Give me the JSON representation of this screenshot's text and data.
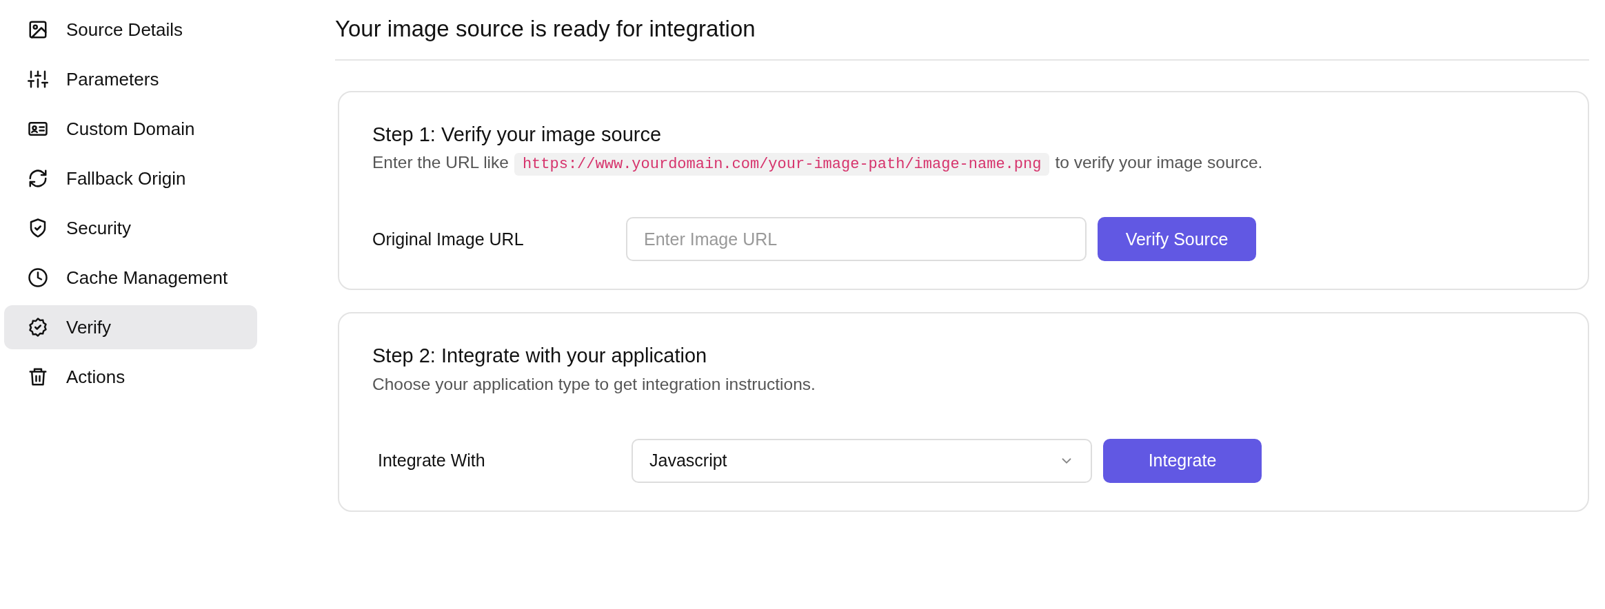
{
  "sidebar": {
    "items": [
      {
        "label": "Source Details",
        "selected": false
      },
      {
        "label": "Parameters",
        "selected": false
      },
      {
        "label": "Custom Domain",
        "selected": false
      },
      {
        "label": "Fallback Origin",
        "selected": false
      },
      {
        "label": "Security",
        "selected": false
      },
      {
        "label": "Cache Management",
        "selected": false
      },
      {
        "label": "Verify",
        "selected": true
      },
      {
        "label": "Actions",
        "selected": false
      }
    ]
  },
  "page_title": "Your image source is ready for integration",
  "steps": [
    {
      "title": "Step 1: Verify your image source",
      "kind": "input",
      "description_before": "Enter the URL like",
      "code": "https://www.yourdomain.com/your-image-path/image-name.png",
      "description_after": "to verify your image source.",
      "field_label": "Original Image URL",
      "placeholder": "Enter Image URL",
      "button": "Verify Source"
    },
    {
      "title": "Step 2: Integrate with your application",
      "kind": "select",
      "description_before": "Choose your application type to get integration instructions.",
      "field_label": "Integrate With",
      "value": "Javascript",
      "button": "Integrate"
    }
  ]
}
